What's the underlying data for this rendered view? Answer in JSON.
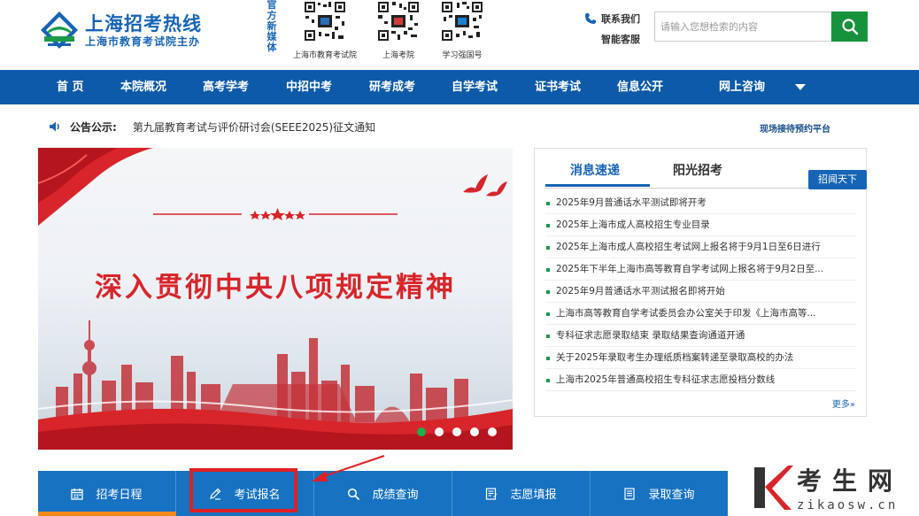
{
  "header": {
    "site_title": "上海招考热线",
    "site_subtitle": "上海市教育考试院主办",
    "media_label": "官方新媒体",
    "qr_codes": [
      {
        "caption": "上海市教育考试院"
      },
      {
        "caption": "上海考院"
      },
      {
        "caption": "学习强国号"
      }
    ],
    "contact_us": "联系我们",
    "smart_service": "智能客服",
    "search_placeholder": "请输入您想检索的内容",
    "search_icon": "search-icon"
  },
  "nav": {
    "items": [
      {
        "label": "首 页"
      },
      {
        "label": "本院概况"
      },
      {
        "label": "高考学考"
      },
      {
        "label": "中招中考"
      },
      {
        "label": "研考成考"
      },
      {
        "label": "自学考试"
      },
      {
        "label": "证书考试"
      },
      {
        "label": "信息公开"
      },
      {
        "label": "网上咨询"
      }
    ]
  },
  "notice": {
    "label": "公告公示:",
    "text": "第九届教育考试与评价研讨会(SEEE2025)征文通知",
    "onsite_link": "现场接待预约平台"
  },
  "banner": {
    "headline": "深入贯彻中央八项规定精神",
    "slide_count": 5,
    "active_slide": 1
  },
  "news": {
    "tabs": [
      {
        "label": "消息速递",
        "active": true
      },
      {
        "label": "阳光招考",
        "active": false
      }
    ],
    "tab_button": "招闻天下",
    "items": [
      {
        "title": "2025年9月普通话水平测试即将开考"
      },
      {
        "title": "2025年上海市成人高校招生专业目录"
      },
      {
        "title": "2025年上海市成人高校招生考试网上报名将于9月1日至6日进行"
      },
      {
        "title": "2025年下半年上海市高等教育自学考试网上报名将于9月2日至..."
      },
      {
        "title": "2025年9月普通话水平测试报名即将开始"
      },
      {
        "title": "上海市高等教育自学考试委员会办公室关于印发《上海市高等..."
      },
      {
        "title": "专科征求志愿录取结束 录取结果查询通道开通"
      },
      {
        "title": "关于2025年录取考生办理纸质档案转递至录取高校的办法"
      },
      {
        "title": "上海市2025年普通高校招生专科征求志愿投档分数线"
      }
    ],
    "more": "更多»"
  },
  "quick_links": [
    {
      "label": "招考日程",
      "icon": "calendar-icon"
    },
    {
      "label": "考试报名",
      "icon": "pen-icon"
    },
    {
      "label": "成绩查询",
      "icon": "search-icon"
    },
    {
      "label": "志愿填报",
      "icon": "form-icon"
    },
    {
      "label": "录取查询",
      "icon": "document-icon"
    }
  ],
  "watermark": {
    "brand": "考生网",
    "url": "zikaosw.cn"
  },
  "colors": {
    "brand_blue": "#1764b6",
    "nav_blue": "#0d5aa8",
    "search_green": "#17923c",
    "quick_blue": "#1772c2",
    "banner_red": "#d7252a",
    "highlight_red": "#e02020"
  }
}
